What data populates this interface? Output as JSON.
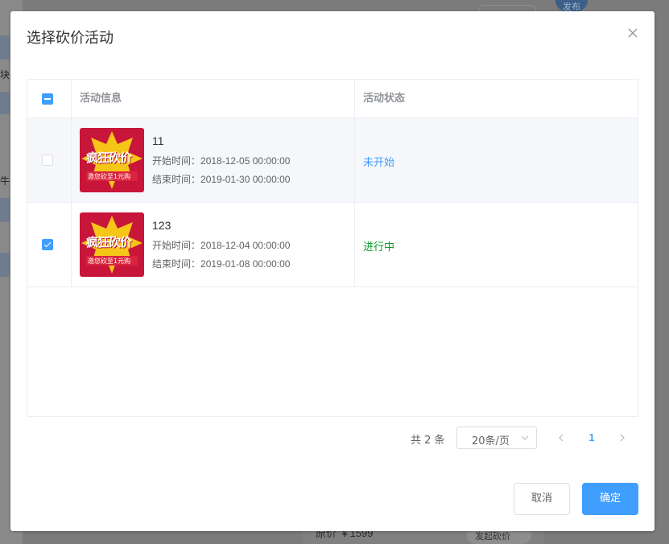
{
  "background": {
    "left_letters": [
      "块",
      "牛"
    ],
    "price_label": "原价 ￥1599",
    "start_button": "发起砍价",
    "publish_button": "发布"
  },
  "dialog": {
    "title": "选择砍价活动",
    "columns": {
      "info": "活动信息",
      "status": "活动状态"
    },
    "rows": [
      {
        "name": "11",
        "start_label": "开始时间：",
        "start_time": "2018-12-05 00:00:00",
        "end_label": "结束时间：",
        "end_time": "2019-01-30 00:00:00",
        "status": "未开始",
        "status_color": "#409eff",
        "checked": false,
        "thumb_text": "疯狂砍价",
        "thumb_sub": "邀您砍至1元购"
      },
      {
        "name": "123",
        "start_label": "开始时间：",
        "start_time": "2018-12-04 00:00:00",
        "end_label": "结束时间：",
        "end_time": "2019-01-08 00:00:00",
        "status": "进行中",
        "status_color": "#0a9a2a",
        "checked": true,
        "thumb_text": "疯狂砍价",
        "thumb_sub": "邀您砍至1元购"
      }
    ],
    "pagination": {
      "total": "共 2 条",
      "page_size": "20条/页",
      "current_page": "1"
    },
    "buttons": {
      "cancel": "取消",
      "confirm": "确定"
    }
  },
  "colors": {
    "primary": "#409eff",
    "border": "#ebeef5",
    "thumb_bg": "#c8153a",
    "thumb_star": "#f5c518"
  }
}
